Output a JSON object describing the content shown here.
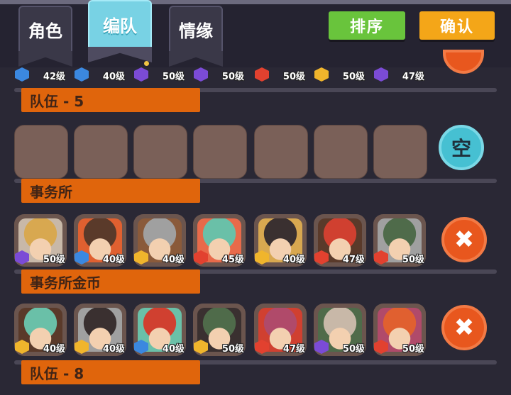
{
  "tabs": [
    {
      "label": "角色",
      "active": false
    },
    {
      "label": "编队",
      "active": true
    },
    {
      "label": "情缘",
      "active": false
    }
  ],
  "buttons": {
    "sort": "排序",
    "confirm": "确认"
  },
  "colors": {
    "sort": "#69c43c",
    "confirm": "#f4a618",
    "label_bg": "#e0650c",
    "empty_btn": "#46c0d2",
    "remove_btn": "#e8571e"
  },
  "teams": [
    {
      "label": "",
      "members": [
        {
          "element": "water",
          "level": "42级"
        },
        {
          "element": "water",
          "level": "40级"
        },
        {
          "element": "dark",
          "level": "50级"
        },
        {
          "element": "dark",
          "level": "50级"
        },
        {
          "element": "fire",
          "level": "50级"
        },
        {
          "element": "light",
          "level": "50级"
        },
        {
          "element": "dark",
          "level": "47级"
        }
      ]
    },
    {
      "label": "队伍 - 5",
      "members": [],
      "side_button": "空"
    },
    {
      "label": "事务所",
      "side_button": "✖",
      "members": [
        {
          "element": "dark",
          "level": "50级"
        },
        {
          "element": "water",
          "level": "40级"
        },
        {
          "element": "light",
          "level": "40级"
        },
        {
          "element": "fire",
          "level": "45级"
        },
        {
          "element": "light",
          "level": "40级"
        },
        {
          "element": "fire",
          "level": "47级"
        },
        {
          "element": "fire",
          "level": "50级"
        }
      ]
    },
    {
      "label": "事务所金币",
      "side_button": "✖",
      "members": [
        {
          "element": "light",
          "level": "40级"
        },
        {
          "element": "light",
          "level": "40级"
        },
        {
          "element": "water",
          "level": "40级"
        },
        {
          "element": "light",
          "level": "50级"
        },
        {
          "element": "fire",
          "level": "47级"
        },
        {
          "element": "dark",
          "level": "50级"
        },
        {
          "element": "fire",
          "level": "50级"
        }
      ]
    },
    {
      "label": "队伍 - 8",
      "members": []
    }
  ]
}
